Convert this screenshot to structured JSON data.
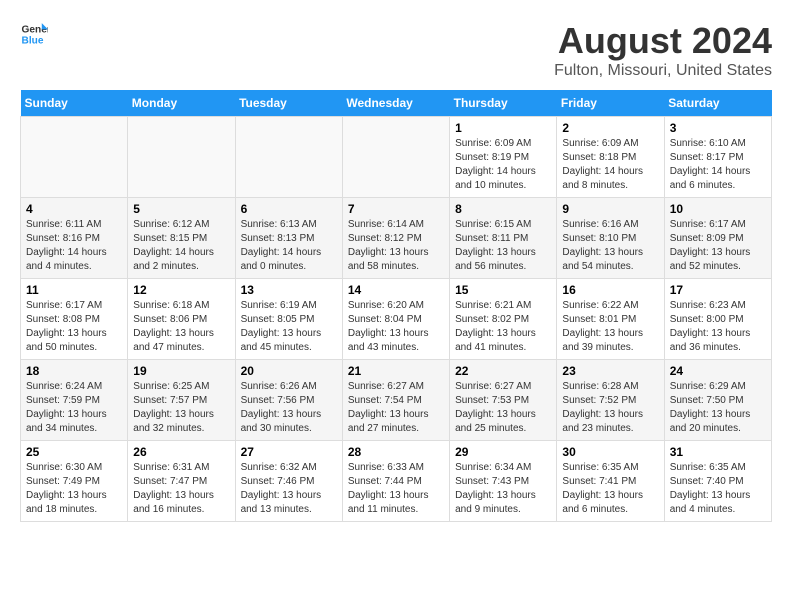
{
  "header": {
    "logo_line1": "General",
    "logo_line2": "Blue",
    "main_title": "August 2024",
    "subtitle": "Fulton, Missouri, United States"
  },
  "days_of_week": [
    "Sunday",
    "Monday",
    "Tuesday",
    "Wednesday",
    "Thursday",
    "Friday",
    "Saturday"
  ],
  "weeks": [
    [
      {
        "day": "",
        "info": ""
      },
      {
        "day": "",
        "info": ""
      },
      {
        "day": "",
        "info": ""
      },
      {
        "day": "",
        "info": ""
      },
      {
        "day": "1",
        "info": "Sunrise: 6:09 AM\nSunset: 8:19 PM\nDaylight: 14 hours\nand 10 minutes."
      },
      {
        "day": "2",
        "info": "Sunrise: 6:09 AM\nSunset: 8:18 PM\nDaylight: 14 hours\nand 8 minutes."
      },
      {
        "day": "3",
        "info": "Sunrise: 6:10 AM\nSunset: 8:17 PM\nDaylight: 14 hours\nand 6 minutes."
      }
    ],
    [
      {
        "day": "4",
        "info": "Sunrise: 6:11 AM\nSunset: 8:16 PM\nDaylight: 14 hours\nand 4 minutes."
      },
      {
        "day": "5",
        "info": "Sunrise: 6:12 AM\nSunset: 8:15 PM\nDaylight: 14 hours\nand 2 minutes."
      },
      {
        "day": "6",
        "info": "Sunrise: 6:13 AM\nSunset: 8:13 PM\nDaylight: 14 hours\nand 0 minutes."
      },
      {
        "day": "7",
        "info": "Sunrise: 6:14 AM\nSunset: 8:12 PM\nDaylight: 13 hours\nand 58 minutes."
      },
      {
        "day": "8",
        "info": "Sunrise: 6:15 AM\nSunset: 8:11 PM\nDaylight: 13 hours\nand 56 minutes."
      },
      {
        "day": "9",
        "info": "Sunrise: 6:16 AM\nSunset: 8:10 PM\nDaylight: 13 hours\nand 54 minutes."
      },
      {
        "day": "10",
        "info": "Sunrise: 6:17 AM\nSunset: 8:09 PM\nDaylight: 13 hours\nand 52 minutes."
      }
    ],
    [
      {
        "day": "11",
        "info": "Sunrise: 6:17 AM\nSunset: 8:08 PM\nDaylight: 13 hours\nand 50 minutes."
      },
      {
        "day": "12",
        "info": "Sunrise: 6:18 AM\nSunset: 8:06 PM\nDaylight: 13 hours\nand 47 minutes."
      },
      {
        "day": "13",
        "info": "Sunrise: 6:19 AM\nSunset: 8:05 PM\nDaylight: 13 hours\nand 45 minutes."
      },
      {
        "day": "14",
        "info": "Sunrise: 6:20 AM\nSunset: 8:04 PM\nDaylight: 13 hours\nand 43 minutes."
      },
      {
        "day": "15",
        "info": "Sunrise: 6:21 AM\nSunset: 8:02 PM\nDaylight: 13 hours\nand 41 minutes."
      },
      {
        "day": "16",
        "info": "Sunrise: 6:22 AM\nSunset: 8:01 PM\nDaylight: 13 hours\nand 39 minutes."
      },
      {
        "day": "17",
        "info": "Sunrise: 6:23 AM\nSunset: 8:00 PM\nDaylight: 13 hours\nand 36 minutes."
      }
    ],
    [
      {
        "day": "18",
        "info": "Sunrise: 6:24 AM\nSunset: 7:59 PM\nDaylight: 13 hours\nand 34 minutes."
      },
      {
        "day": "19",
        "info": "Sunrise: 6:25 AM\nSunset: 7:57 PM\nDaylight: 13 hours\nand 32 minutes."
      },
      {
        "day": "20",
        "info": "Sunrise: 6:26 AM\nSunset: 7:56 PM\nDaylight: 13 hours\nand 30 minutes."
      },
      {
        "day": "21",
        "info": "Sunrise: 6:27 AM\nSunset: 7:54 PM\nDaylight: 13 hours\nand 27 minutes."
      },
      {
        "day": "22",
        "info": "Sunrise: 6:27 AM\nSunset: 7:53 PM\nDaylight: 13 hours\nand 25 minutes."
      },
      {
        "day": "23",
        "info": "Sunrise: 6:28 AM\nSunset: 7:52 PM\nDaylight: 13 hours\nand 23 minutes."
      },
      {
        "day": "24",
        "info": "Sunrise: 6:29 AM\nSunset: 7:50 PM\nDaylight: 13 hours\nand 20 minutes."
      }
    ],
    [
      {
        "day": "25",
        "info": "Sunrise: 6:30 AM\nSunset: 7:49 PM\nDaylight: 13 hours\nand 18 minutes."
      },
      {
        "day": "26",
        "info": "Sunrise: 6:31 AM\nSunset: 7:47 PM\nDaylight: 13 hours\nand 16 minutes."
      },
      {
        "day": "27",
        "info": "Sunrise: 6:32 AM\nSunset: 7:46 PM\nDaylight: 13 hours\nand 13 minutes."
      },
      {
        "day": "28",
        "info": "Sunrise: 6:33 AM\nSunset: 7:44 PM\nDaylight: 13 hours\nand 11 minutes."
      },
      {
        "day": "29",
        "info": "Sunrise: 6:34 AM\nSunset: 7:43 PM\nDaylight: 13 hours\nand 9 minutes."
      },
      {
        "day": "30",
        "info": "Sunrise: 6:35 AM\nSunset: 7:41 PM\nDaylight: 13 hours\nand 6 minutes."
      },
      {
        "day": "31",
        "info": "Sunrise: 6:35 AM\nSunset: 7:40 PM\nDaylight: 13 hours\nand 4 minutes."
      }
    ]
  ]
}
